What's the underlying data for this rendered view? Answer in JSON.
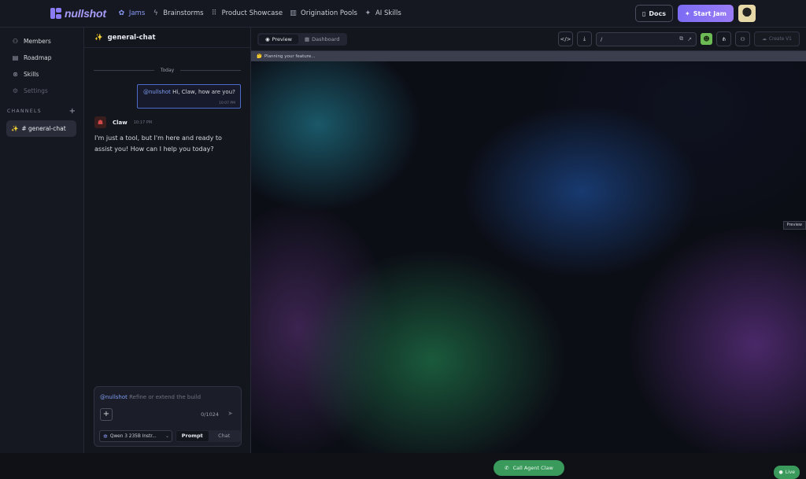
{
  "brand": {
    "name": "nullshot",
    "color": "#8b7cf6"
  },
  "nav": [
    {
      "label": "Jams",
      "icon": "gear-icon",
      "glyph": "✿"
    },
    {
      "label": "Brainstorms",
      "icon": "lightning-icon",
      "glyph": "ϟ"
    },
    {
      "label": "Product Showcase",
      "icon": "grid-icon",
      "glyph": "⠿"
    },
    {
      "label": "Origination Pools",
      "icon": "bar-chart-icon",
      "glyph": "▥"
    },
    {
      "label": "AI Skills",
      "icon": "sparkle-icon",
      "glyph": "✦"
    }
  ],
  "header": {
    "docs_label": "Docs",
    "start_jam_label": "Start Jam",
    "accent": "#7c6cf4"
  },
  "sidebar": {
    "items": [
      {
        "label": "Members",
        "glyph": "⚇"
      },
      {
        "label": "Roadmap",
        "glyph": "▤"
      },
      {
        "label": "Skills",
        "glyph": "⊛"
      },
      {
        "label": "Settings",
        "glyph": "⚙"
      }
    ],
    "channels_heading": "CHANNELS",
    "add_glyph": "+",
    "channel": {
      "emoji": "✨",
      "name": "# general-chat"
    }
  },
  "chat": {
    "title": "general-chat",
    "title_emoji": "✨",
    "divider": "Today",
    "user_message": {
      "mention": "@nullshot",
      "text": " Hi, Claw, how are you?",
      "time": "10:07 PM"
    },
    "bot": {
      "name": "Claw",
      "time": "10:17 PM",
      "text": "I'm just a tool, but I'm here and ready to assist you! How can I help you today?"
    },
    "composer": {
      "mention": "@nullshot",
      "placeholder": " Refine or extend the build",
      "counter": "0/1024",
      "model": "Qwen 3 235B Instr...",
      "modes": [
        "Prompt",
        "Chat"
      ]
    }
  },
  "preview": {
    "tabs": [
      {
        "label": "Preview",
        "glyph": "◉"
      },
      {
        "label": "Dashboard",
        "glyph": "▦"
      }
    ],
    "url_path": "/",
    "create_label": "Create V1",
    "status_text": "Planning your feature...",
    "status_emoji": "🤔",
    "chip_label": "Preview",
    "call_label": "Call Agent Claw",
    "live_label": "Live",
    "live_color": "#3a9a5c"
  }
}
